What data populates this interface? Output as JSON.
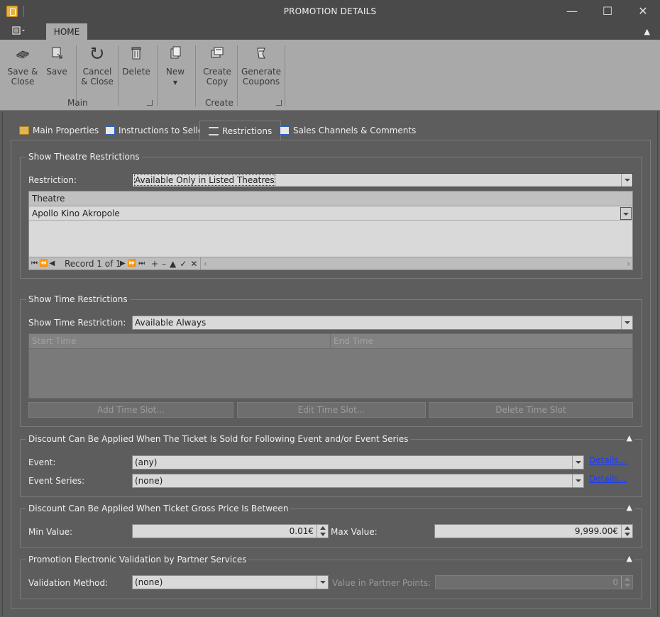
{
  "window": {
    "title": "PROMOTION DETAILS"
  },
  "ribbon": {
    "home_tab": "HOME",
    "buttons": {
      "save_close": "Save &\nClose",
      "save": "Save",
      "cancel_close": "Cancel\n& Close",
      "delete": "Delete",
      "new": "New",
      "create_copy": "Create\nCopy",
      "generate_coupons": "Generate\nCoupons"
    },
    "groups": {
      "main": "Main",
      "create": "Create"
    }
  },
  "tabs": [
    {
      "label": "Main Properties"
    },
    {
      "label": "Instructions to Seller"
    },
    {
      "label": "Restrictions"
    },
    {
      "label": "Sales Channels & Comments"
    }
  ],
  "theatre_restrictions": {
    "title": "Show Theatre Restrictions",
    "restriction_label": "Restriction:",
    "restriction_value": "Available Only in Listed Theatres",
    "grid_header": "Theatre",
    "rows": [
      "Apollo Kino Akropole"
    ],
    "nav_record": "Record 1 of 1"
  },
  "time_restrictions": {
    "title": "Show Time Restrictions",
    "label": "Show Time Restriction:",
    "value": "Available Always",
    "col_start": "Start Time",
    "col_end": "End Time",
    "add_button": "Add Time Slot...",
    "edit_button": "Edit Time Slot...",
    "delete_button": "Delete Time Slot"
  },
  "event_section": {
    "title": "Discount Can Be Applied When The Ticket Is Sold for Following Event and/or Event Series",
    "event_label": "Event:",
    "event_value": "(any)",
    "event_details": "Details...",
    "series_label": "Event Series:",
    "series_value": "(none)",
    "series_details": "Details..."
  },
  "price_section": {
    "title": "Discount Can Be Applied When Ticket Gross Price Is Between",
    "min_label": "Min Value:",
    "min_value": "0.01€",
    "max_label": "Max Value:",
    "max_value": "9,999.00€"
  },
  "validation_section": {
    "title": "Promotion Electronic Validation by Partner Services",
    "method_label": "Validation Method:",
    "method_value": "(none)",
    "points_label": "Value in Partner Points:",
    "points_value": "0"
  }
}
